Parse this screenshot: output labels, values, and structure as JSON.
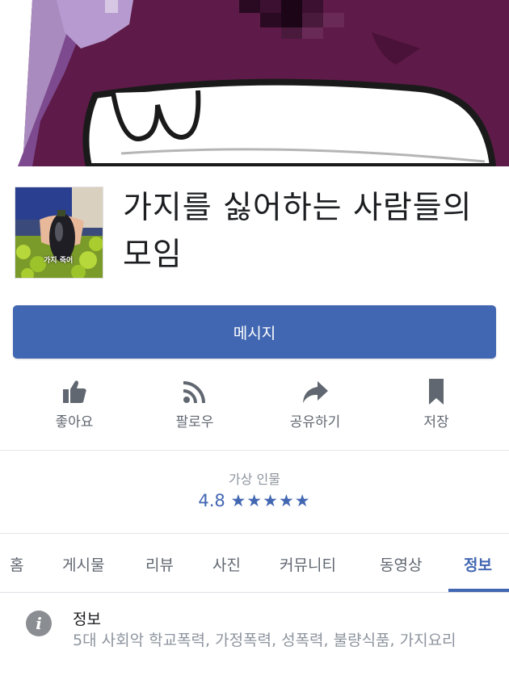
{
  "cover": {
    "icon": "eggplant-cartoon-pixelated-cover"
  },
  "profile": {
    "icon": "eggplant-in-hand-photo",
    "caption": "가지 죽어"
  },
  "page": {
    "title": "가지를 싫어하는 사람들의 모임"
  },
  "message_button": {
    "label": "메시지"
  },
  "actions": [
    {
      "label": "좋아요",
      "icon": "thumbs-up-icon"
    },
    {
      "label": "팔로우",
      "icon": "rss-icon"
    },
    {
      "label": "공유하기",
      "icon": "share-arrow-icon"
    },
    {
      "label": "저장",
      "icon": "bookmark-icon"
    }
  ],
  "rating": {
    "category": "가상 인물",
    "score": "4.8",
    "stars": "★★★★★"
  },
  "tabs": [
    {
      "label": "홈",
      "active": false
    },
    {
      "label": "게시물",
      "active": false
    },
    {
      "label": "리뷰",
      "active": false
    },
    {
      "label": "사진",
      "active": false
    },
    {
      "label": "커뮤니티",
      "active": false
    },
    {
      "label": "동영상",
      "active": false
    },
    {
      "label": "정보",
      "active": true
    }
  ],
  "info": {
    "icon": "info-icon",
    "icon_glyph": "i",
    "heading": "정보",
    "text": "5대 사회악  학교폭력, 가정폭력, 성폭력, 불량식품, 가지요리"
  },
  "colors": {
    "accent": "#4267b2",
    "cover_purple": "#5e1a48",
    "secondary_text": "#606770"
  }
}
